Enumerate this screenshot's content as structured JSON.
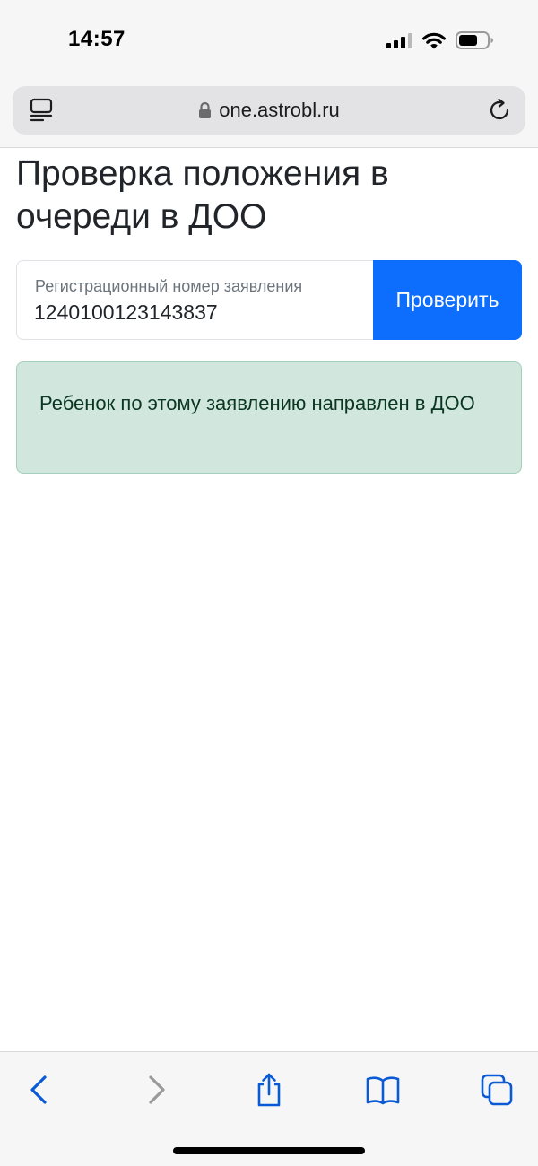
{
  "status_bar": {
    "time": "14:57",
    "icons": [
      "cellular-signal-icon",
      "wifi-icon",
      "battery-icon"
    ]
  },
  "browser": {
    "url": "one.astrobl.ru",
    "icons": [
      "reader-icon",
      "lock-icon",
      "reload-icon"
    ]
  },
  "page": {
    "title": "Проверка положения в очереди в ДОО",
    "form": {
      "label": "Регистрационный номер заявления",
      "value": "1240100123143837",
      "button_label": "Проверить"
    },
    "alert": {
      "text": "Ребенок по этому заявлению направлен в ДОО"
    }
  },
  "toolbar": {
    "icons": [
      "back-icon",
      "forward-icon",
      "share-icon",
      "bookmarks-icon",
      "tabs-icon"
    ]
  },
  "colors": {
    "primary": "#0d6efd",
    "alert_bg": "#d1e7dd",
    "alert_border": "#a3cfbb",
    "alert_text": "#0a3622",
    "toolbar_accent": "#0a5ad6",
    "toolbar_disabled": "#9a9a9a"
  }
}
